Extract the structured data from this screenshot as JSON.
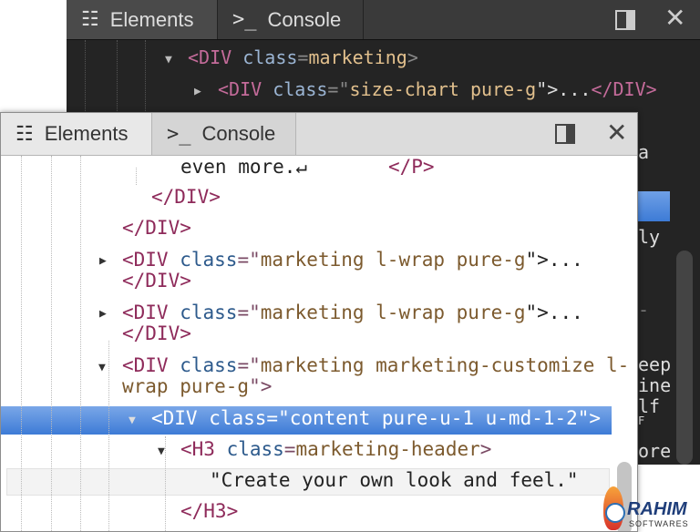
{
  "back_panel": {
    "tabs": [
      {
        "label": "Elements",
        "icon": "elements-icon"
      },
      {
        "label": "Console",
        "icon": "console-icon",
        "glyph": ">_"
      }
    ],
    "lines": [
      {
        "tag": "<DIV",
        "attr": " class",
        "eq": "=",
        "val": "marketing",
        "close": ">"
      },
      {
        "tag": "<DIV",
        "attr": " class",
        "eq": "=\"",
        "val": "size-chart pure-g",
        "close": "\">...",
        "end": "</DIV>"
      }
    ],
    "clipped_text": [
      "a",
      "ly",
      "-",
      "eep",
      "ine",
      "lf",
      "F",
      "ore"
    ]
  },
  "front_panel": {
    "tabs": [
      {
        "label": "Elements",
        "icon": "elements-icon"
      },
      {
        "label": "Console",
        "icon": "console-icon",
        "glyph": ">_"
      }
    ],
    "lines": {
      "l0": "even more.↵",
      "l0b": "</P>",
      "l1": "</DIV>",
      "l2": "</DIV>",
      "l3_tag": "<DIV",
      "l3_attr": " class",
      "l3_eq": "=\"",
      "l3_val": "marketing l-wrap pure-g",
      "l3_close": "\">...",
      "l4": "</DIV>",
      "l5_tag": "<DIV",
      "l5_attr": " class",
      "l5_eq": "=\"",
      "l5_val": "marketing l-wrap pure-g",
      "l5_close": "\">...",
      "l6": "</DIV>",
      "l7_tag": "<DIV",
      "l7_attr": " class",
      "l7_eq": "=\"",
      "l7_val": "marketing marketing-customize l-",
      "l8_val": "wrap pure-g",
      "l8_close": "\">",
      "l9": "<DIV class=\"content pure-u-1 u-md-1-2\">",
      "l10_tag": "<H3",
      "l10_attr": " class",
      "l10_eq": "=",
      "l10_val": "marketing-header",
      "l10_close": ">",
      "l11": "\"Create your own look and feel.\"",
      "l12": "</H3>"
    }
  },
  "watermark": {
    "name": "RAHIM",
    "sub": "SOFTWARES"
  },
  "colors": {
    "selection": "#3d7bd6",
    "dark_bg": "#242424"
  }
}
